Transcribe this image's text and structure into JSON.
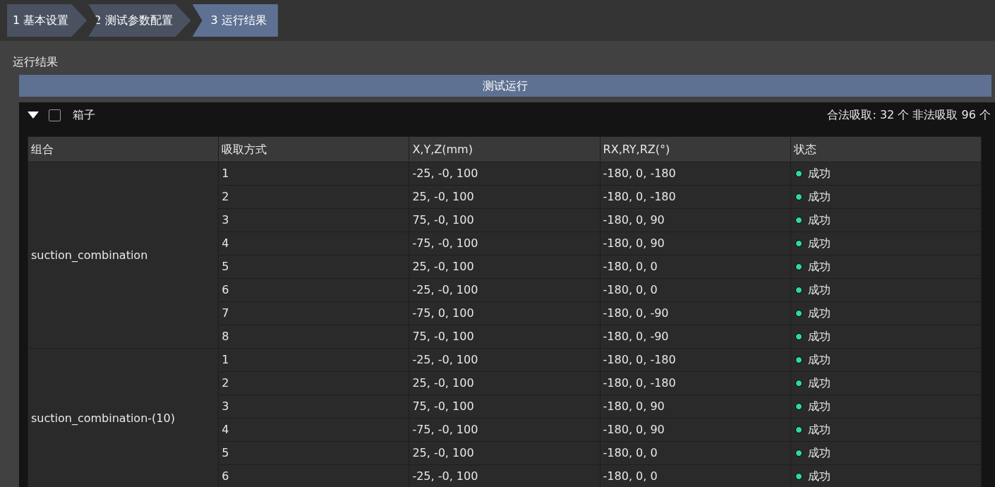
{
  "steps": [
    {
      "label": "1 基本设置",
      "selected": false
    },
    {
      "label": "2 测试参数配置",
      "selected": false
    },
    {
      "label": "3 运行结果",
      "selected": true
    }
  ],
  "section_title": "运行结果",
  "run_button": "测试运行",
  "group": {
    "title": "箱子",
    "expanded": true,
    "checked": false,
    "summary": "合法吸取: 32 个 非法吸取 96 个"
  },
  "table": {
    "columns": [
      "组合",
      "吸取方式",
      "X,Y,Z(mm)",
      "RX,RY,RZ(°)",
      "状态"
    ],
    "groups": [
      {
        "name": "suction_combination",
        "rows": [
          {
            "mode": "1",
            "xyz": "-25, -0, 100",
            "rxyz": "-180, 0, -180",
            "status": "成功",
            "color": "#33d6a0"
          },
          {
            "mode": "2",
            "xyz": "25, -0, 100",
            "rxyz": "-180, 0, -180",
            "status": "成功",
            "color": "#33d6a0"
          },
          {
            "mode": "3",
            "xyz": "75, -0, 100",
            "rxyz": "-180, 0, 90",
            "status": "成功",
            "color": "#33d6a0"
          },
          {
            "mode": "4",
            "xyz": "-75, -0, 100",
            "rxyz": "-180, 0, 90",
            "status": "成功",
            "color": "#33d6a0"
          },
          {
            "mode": "5",
            "xyz": "25, -0, 100",
            "rxyz": "-180, 0, 0",
            "status": "成功",
            "color": "#33d6a0"
          },
          {
            "mode": "6",
            "xyz": "-25, -0, 100",
            "rxyz": "-180, 0, 0",
            "status": "成功",
            "color": "#33d6a0"
          },
          {
            "mode": "7",
            "xyz": "-75, 0, 100",
            "rxyz": "-180, 0, -90",
            "status": "成功",
            "color": "#33d6a0"
          },
          {
            "mode": "8",
            "xyz": "75, -0, 100",
            "rxyz": "-180, 0, -90",
            "status": "成功",
            "color": "#33d6a0"
          }
        ]
      },
      {
        "name": "suction_combination-(10)",
        "rows": [
          {
            "mode": "1",
            "xyz": "-25, -0, 100",
            "rxyz": "-180, 0, -180",
            "status": "成功",
            "color": "#33d6a0"
          },
          {
            "mode": "2",
            "xyz": "25, -0, 100",
            "rxyz": "-180, 0, -180",
            "status": "成功",
            "color": "#33d6a0"
          },
          {
            "mode": "3",
            "xyz": "75, -0, 100",
            "rxyz": "-180, 0, 90",
            "status": "成功",
            "color": "#33d6a0"
          },
          {
            "mode": "4",
            "xyz": "-75, -0, 100",
            "rxyz": "-180, 0, 90",
            "status": "成功",
            "color": "#33d6a0"
          },
          {
            "mode": "5",
            "xyz": "25, -0, 100",
            "rxyz": "-180, 0, 0",
            "status": "成功",
            "color": "#33d6a0"
          },
          {
            "mode": "6",
            "xyz": "-25, -0, 100",
            "rxyz": "-180, 0, 0",
            "status": "成功",
            "color": "#33d6a0"
          }
        ]
      }
    ]
  }
}
